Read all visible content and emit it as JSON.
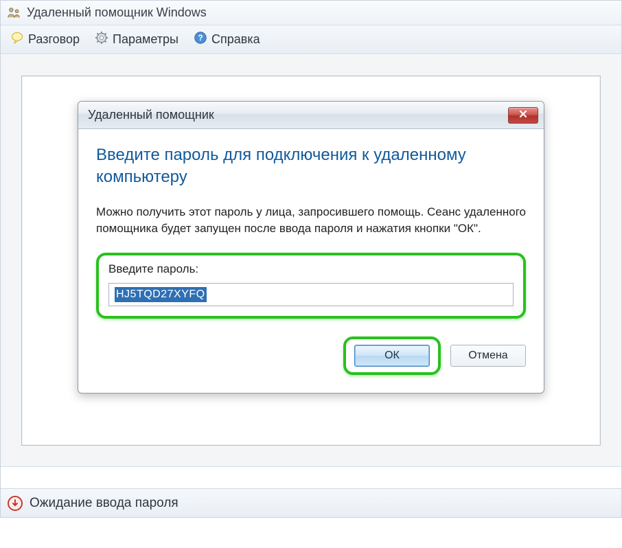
{
  "window": {
    "title": "Удаленный помощник Windows"
  },
  "toolbar": {
    "chat": "Разговор",
    "settings": "Параметры",
    "help": "Справка"
  },
  "dialog": {
    "title": "Удаленный помощник",
    "heading": "Введите пароль для подключения к удаленному компьютеру",
    "description": "Можно получить этот пароль у лица, запросившего помощь.  Сеанс удаленного помощника будет запущен после ввода пароля и нажатия кнопки \"ОК\".",
    "field_label": "Введите пароль:",
    "password_value": "HJ5TQD27XYFQ",
    "ok": "ОК",
    "cancel": "Отмена"
  },
  "status": {
    "text": "Ожидание ввода пароля"
  }
}
